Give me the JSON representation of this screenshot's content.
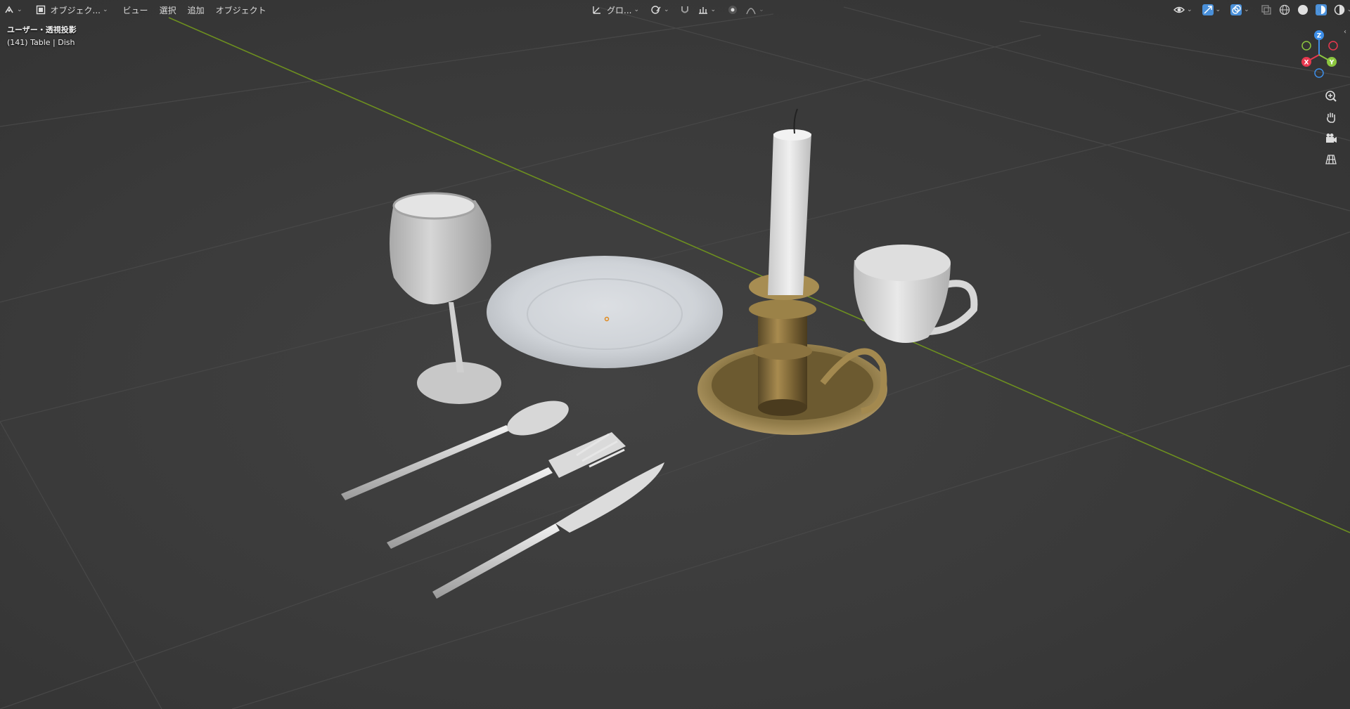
{
  "header": {
    "editor_type": "editor-type",
    "mode_label": "オブジェク...",
    "menus": [
      "ビュー",
      "選択",
      "追加",
      "オブジェクト"
    ],
    "transform_orientation": "グロ..."
  },
  "viewport_info": {
    "view_label": "ユーザー・透視投影",
    "object_label": "(141) Table | Dish"
  },
  "gizmo": {
    "x": "X",
    "y": "Y",
    "z": "Z"
  },
  "colors": {
    "background": "#3b3b3b",
    "x_axis": "#e8384f",
    "y_axis": "#8cc63f",
    "z_axis": "#3d8ee8",
    "floor_y_line": "#6d8f1f",
    "accent": "#4a90d9"
  },
  "icons": [
    "editor-type-icon",
    "object-mode-icon",
    "transform-orientation-icon",
    "pivot-icon",
    "snap-icon",
    "proportional-icon",
    "visibility-icon",
    "gizmo-toggle-icon",
    "overlay-icon",
    "xray-icon",
    "wireframe-shading-icon",
    "solid-shading-icon",
    "material-shading-icon",
    "rendered-shading-icon",
    "zoom-icon",
    "pan-hand-icon",
    "camera-icon",
    "grid-icon"
  ]
}
